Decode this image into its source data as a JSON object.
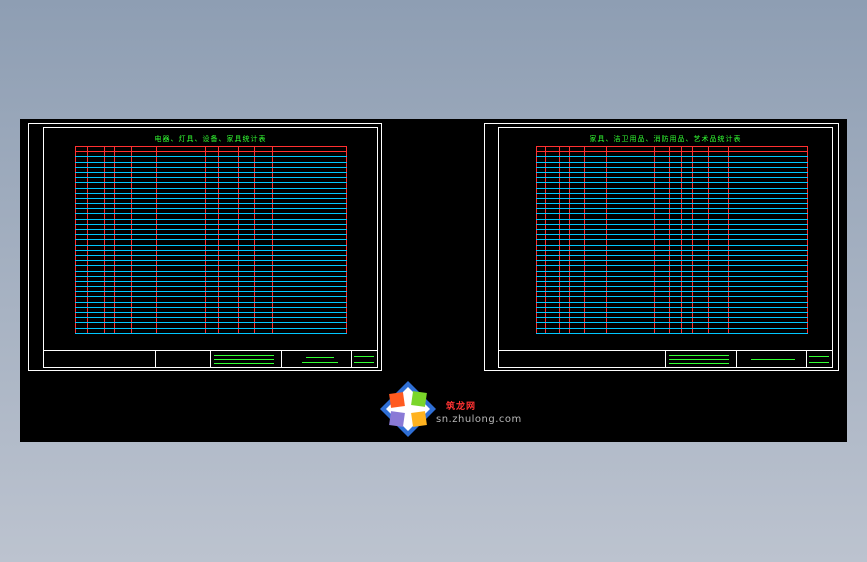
{
  "drawing": {
    "left_sheet": {
      "title": "电器、灯具、设备、家具统计表",
      "rows": 36,
      "cols": 11
    },
    "right_sheet": {
      "title": "家具、洁卫用品、消防用品、艺术品统计表",
      "rows": 36,
      "cols": 12
    }
  },
  "watermark": {
    "brand": "筑龙网",
    "url": "sn.zhulong.com"
  },
  "colors": {
    "background": "#000000",
    "table_border": "#ff3030",
    "row_lines": "#00c8ff",
    "text": "#33ff33",
    "frame": "#ffffff"
  }
}
